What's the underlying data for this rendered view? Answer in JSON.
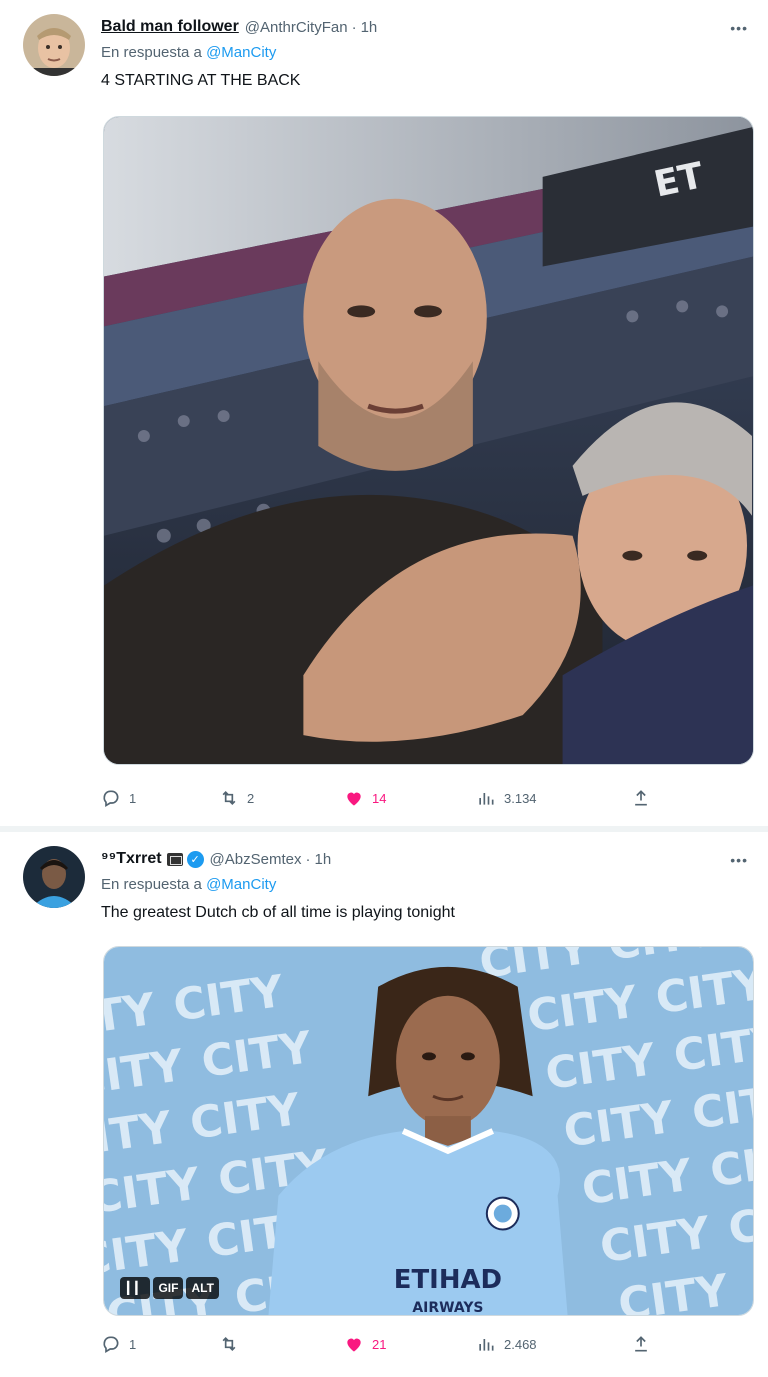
{
  "tweets": [
    {
      "display_name": "Bald man follower",
      "handle": "@AnthrCityFan",
      "time": "1h",
      "reply_label": "En respuesta a",
      "reply_mention": "@ManCity",
      "text": "4 STARTING AT THE BACK",
      "media_type": "photo",
      "stats": {
        "replies": "1",
        "retweets": "2",
        "likes": "14",
        "views": "3.134"
      }
    },
    {
      "display_name": "⁹⁹Txrret",
      "handle": "@AbzSemtex",
      "time": "1h",
      "reply_label": "En respuesta a",
      "reply_mention": "@ManCity",
      "text": "The greatest Dutch cb of all time is playing tonight",
      "media_type": "gif",
      "gif_tags": [
        "GIF",
        "ALT"
      ],
      "gif_background_text": "CITY",
      "jersey_sponsor_line1": "ETIHAD",
      "jersey_sponsor_line2": "AIRWAYS",
      "stadium_sign": "ET",
      "stats": {
        "replies": "1",
        "retweets": "",
        "likes": "21",
        "views": "2.468"
      }
    }
  ],
  "icons": {
    "more": "more-dots-icon",
    "reply": "reply-bubble-icon",
    "retweet": "retweet-icon",
    "like": "heart-filled-icon",
    "views": "views-bar-chart-icon",
    "share": "share-upload-icon",
    "verified": "verified-badge-icon",
    "id_badge": "id-card-icon",
    "pause": "pause-icon"
  },
  "colors": {
    "accent": "#1d9bf0",
    "like": "#f91880",
    "secondary_text": "#536471",
    "gif_background": "#8fbce0"
  }
}
